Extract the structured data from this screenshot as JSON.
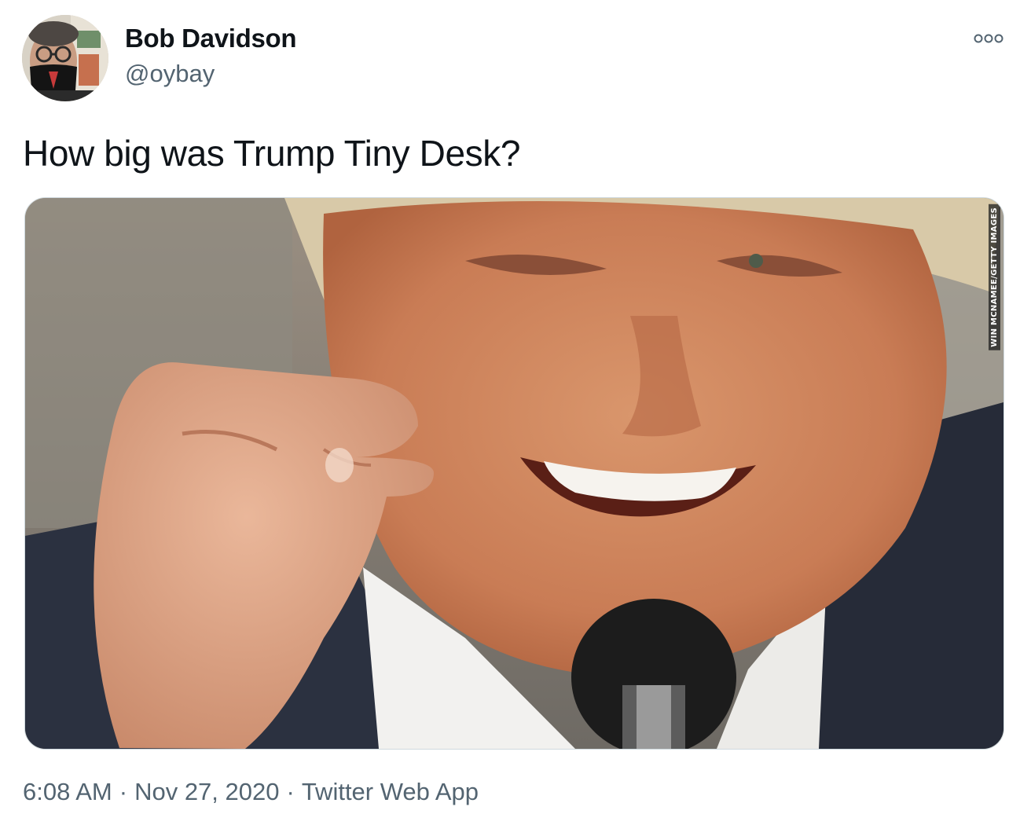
{
  "author": {
    "name": "Bob Davidson",
    "handle": "@oybay",
    "avatar_icon": "profile-photo"
  },
  "tweet": {
    "text": "How big was Trump Tiny Desk?",
    "more_icon": "more-options-icon"
  },
  "media": {
    "photo_credit": "WIN MCNAMEE/GETTY IMAGES"
  },
  "meta": {
    "time": "6:08 AM",
    "date": "Nov 27, 2020",
    "source": "Twitter Web App",
    "separator": "·"
  },
  "colors": {
    "text_primary": "#0f1419",
    "text_secondary": "#536471",
    "border": "#cfd9de"
  }
}
